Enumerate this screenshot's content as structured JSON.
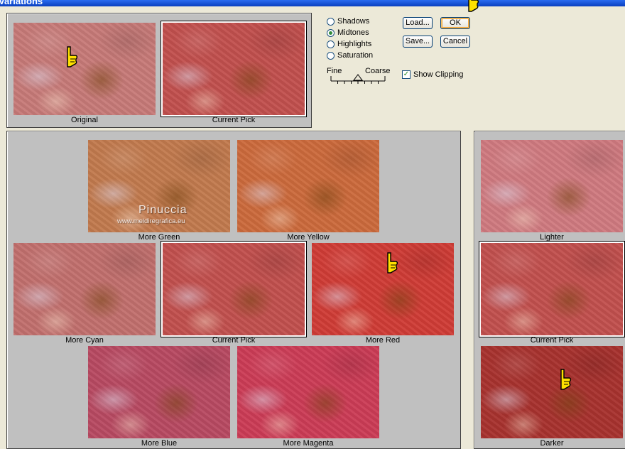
{
  "window": {
    "title": "Variations"
  },
  "top": {
    "original_caption": "Original",
    "current_pick_caption": "Current Pick"
  },
  "tone_options": [
    {
      "label": "Shadows",
      "selected": false
    },
    {
      "label": "Midtones",
      "selected": true
    },
    {
      "label": "Highlights",
      "selected": false
    },
    {
      "label": "Saturation",
      "selected": false
    }
  ],
  "slider": {
    "fine_label": "Fine",
    "coarse_label": "Coarse",
    "value_ticks": 4,
    "total_ticks": 8
  },
  "buttons": {
    "load": "Load...",
    "ok": "OK",
    "save": "Save...",
    "cancel": "Cancel"
  },
  "show_clipping": {
    "label": "Show Clipping",
    "checked": true
  },
  "color_grid": {
    "more_green": "More Green",
    "more_yellow": "More Yellow",
    "more_cyan": "More Cyan",
    "current_pick": "Current Pick",
    "more_red": "More Red",
    "more_blue": "More Blue",
    "more_magenta": "More Magenta"
  },
  "brightness": {
    "lighter": "Lighter",
    "current_pick": "Current Pick",
    "darker": "Darker"
  },
  "watermark": {
    "title": "Pinuccia",
    "url": "www.meldiregrafica.eu"
  },
  "tints": {
    "original": "#c77a78",
    "current": "#c2504e",
    "green": "#c27a4e",
    "yellow": "#cc6a3c",
    "cyan": "#c2706e",
    "red": "#d03c36",
    "blue": "#b84a62",
    "magenta": "#cc3c56",
    "lighter": "#d07a80",
    "darker": "#a8322e"
  }
}
